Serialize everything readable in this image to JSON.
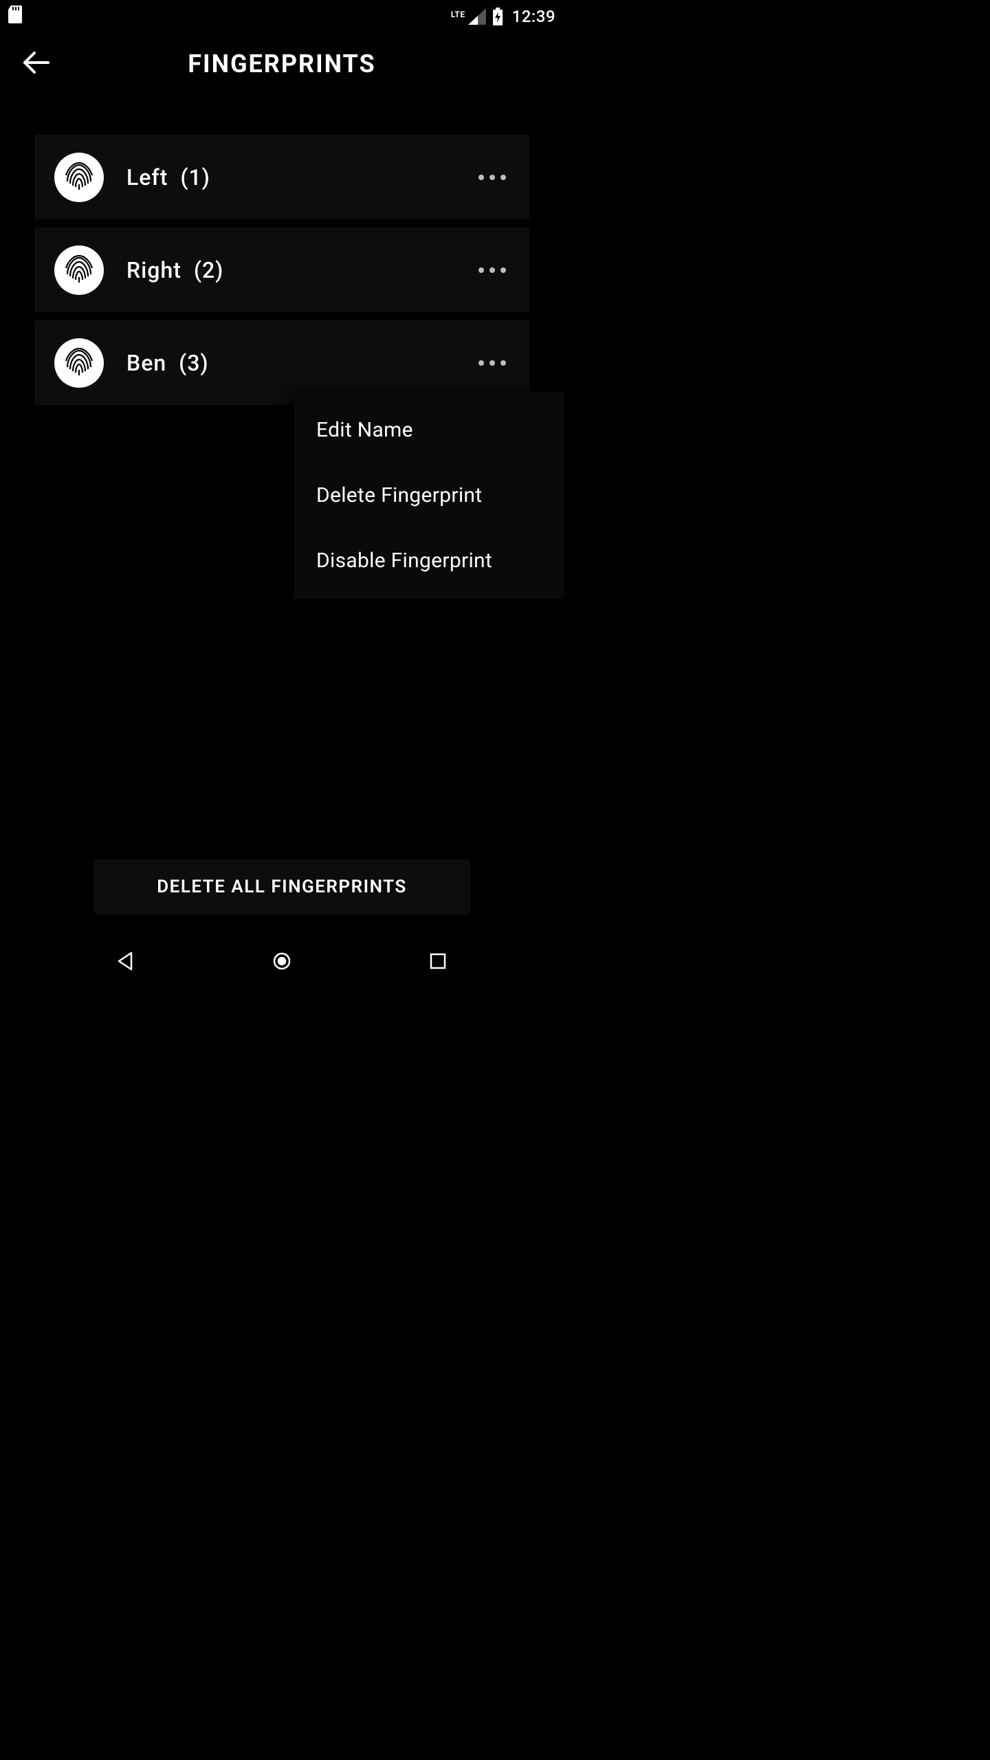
{
  "status_bar": {
    "network_label": "LTE",
    "clock": "12:39"
  },
  "header": {
    "title": "FINGERPRINTS"
  },
  "fingerprints": [
    {
      "name": "Left",
      "index": "(1)"
    },
    {
      "name": "Right",
      "index": "(2)"
    },
    {
      "name": "Ben",
      "index": "(3)"
    }
  ],
  "popup": {
    "items": [
      "Edit Name",
      "Delete Fingerprint",
      "Disable Fingerprint"
    ]
  },
  "delete_all_label": "DELETE ALL FINGERPRINTS"
}
